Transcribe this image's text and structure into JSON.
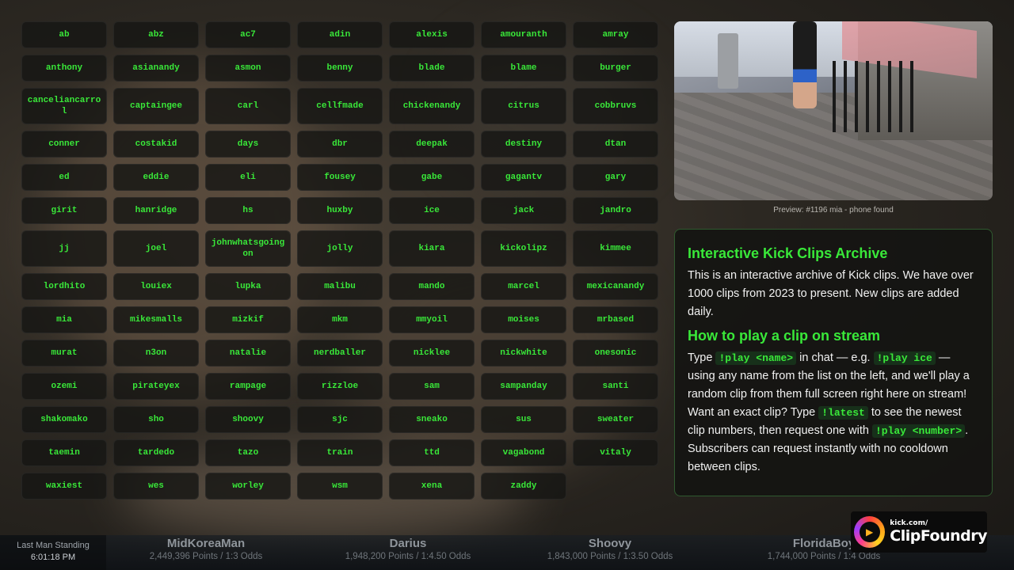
{
  "names": [
    "ab",
    "abz",
    "ac7",
    "adin",
    "alexis",
    "amouranth",
    "amray",
    "anthony",
    "asianandy",
    "asmon",
    "benny",
    "blade",
    "blame",
    "burger",
    "canceliancarrol",
    "captaingee",
    "carl",
    "cellfmade",
    "chickenandy",
    "citrus",
    "cobbruvs",
    "conner",
    "costakid",
    "days",
    "dbr",
    "deepak",
    "destiny",
    "dtan",
    "ed",
    "eddie",
    "eli",
    "fousey",
    "gabe",
    "gagantv",
    "gary",
    "girit",
    "hanridge",
    "hs",
    "huxby",
    "ice",
    "jack",
    "jandro",
    "jj",
    "joel",
    "johnwhatsgoingon",
    "jolly",
    "kiara",
    "kickolipz",
    "kimmee",
    "lordhito",
    "louiex",
    "lupka",
    "malibu",
    "mando",
    "marcel",
    "mexicanandy",
    "mia",
    "mikesmalls",
    "mizkif",
    "mkm",
    "mmyoil",
    "moises",
    "mrbased",
    "murat",
    "n3on",
    "natalie",
    "nerdballer",
    "nicklee",
    "nickwhite",
    "onesonic",
    "ozemi",
    "pirateyex",
    "rampage",
    "rizzloe",
    "sam",
    "sampanday",
    "santi",
    "shakomako",
    "sho",
    "shoovy",
    "sjc",
    "sneako",
    "sus",
    "sweater",
    "taemin",
    "tardedo",
    "tazo",
    "train",
    "ttd",
    "vagabond",
    "vitaly",
    "waxiest",
    "wes",
    "worley",
    "wsm",
    "xena",
    "zaddy"
  ],
  "preview": {
    "caption": "Preview: #1196 mia - phone found"
  },
  "info": {
    "title": "Interactive Kick Clips Archive",
    "description": "This is an interactive archive of Kick clips. We have over 1000 clips from 2023 to present. New clips are added daily.",
    "howto_title": "How to play a clip on stream",
    "cmd_play_name": "!play <name>",
    "cmd_play_ice": "!play ice",
    "cmd_latest": "!latest",
    "cmd_play_number": "!play <number>",
    "text_type": "Type",
    "text_in_chat": "in chat — e.g.",
    "text_using": "— using any name from the list on the left, and we'll play a random clip from them full screen right here on stream! Want an exact clip? Type",
    "text_see": "to see the newest clip numbers, then request one with",
    "text_subs": ". Subscribers can request instantly with no cooldown between clips."
  },
  "ticker": {
    "label": "Last Man Standing",
    "time": "6:01:18 PM",
    "players": [
      {
        "name": "MidKoreaMan",
        "stats": "2,449,396 Points / 1:3 Odds"
      },
      {
        "name": "Darius",
        "stats": "1,948,200 Points / 1:4.50 Odds"
      },
      {
        "name": "Shoovy",
        "stats": "1,843,000 Points / 1:3.50 Odds"
      },
      {
        "name": "FloridaBoy",
        "stats": "1,744,000 Points / 1:4 Odds"
      }
    ]
  },
  "logo": {
    "top": "kick.com/",
    "brand": "ClipFoundry",
    "icon": "play-icon"
  }
}
